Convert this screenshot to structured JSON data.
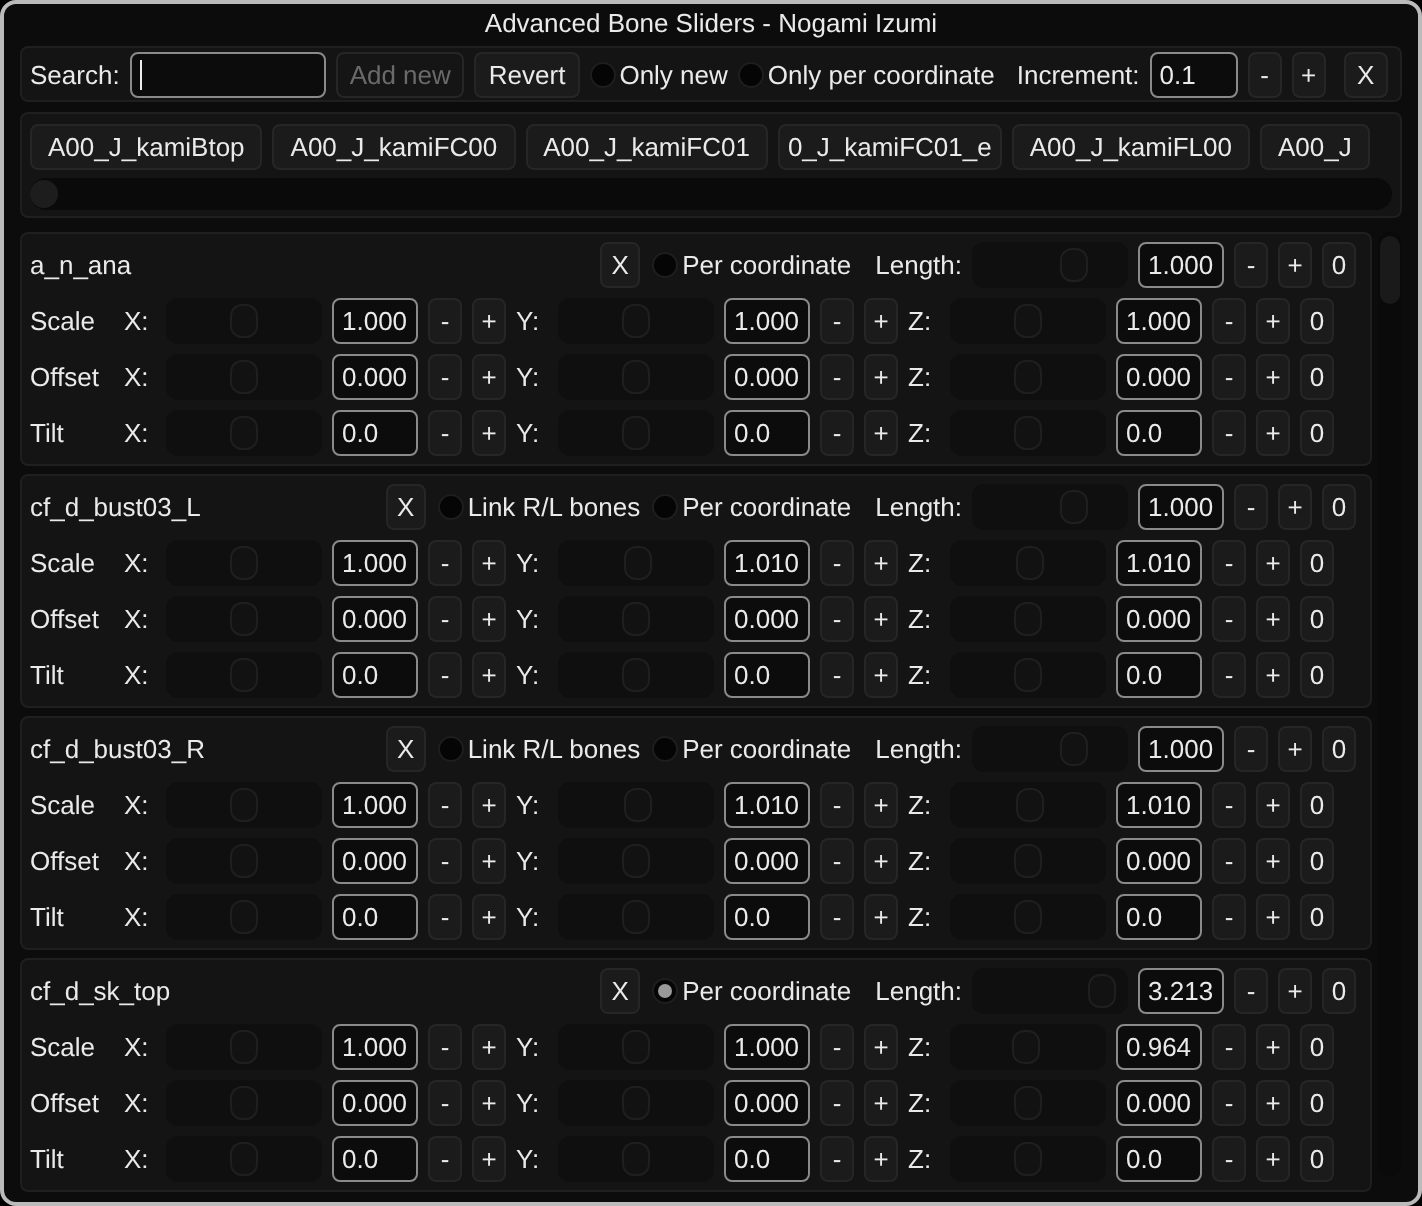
{
  "window": {
    "title": "Advanced Bone Sliders - Nogami Izumi"
  },
  "toolbar": {
    "search_label": "Search:",
    "buttons": [
      {
        "label": "Add new",
        "disabled": true
      },
      {
        "label": "Revert",
        "disabled": false
      }
    ],
    "toggles": [
      {
        "label": "Only new",
        "on": false
      },
      {
        "label": "Only per coordinate",
        "on": false
      }
    ],
    "increment_label": "Increment:",
    "increment_value": "0.1",
    "dec": "-",
    "inc": "+",
    "close": "X"
  },
  "tabs": [
    "A00_J_kamiBtop",
    "A00_J_kamiFC00",
    "A00_J_kamiFC01",
    "0_J_kamiFC01_e",
    "A00_J_kamiFL00",
    "A00_J"
  ],
  "bones": [
    {
      "name": "a_n_ana",
      "remove": "X",
      "toggles": [
        {
          "label": "Per coordinate",
          "on": false
        }
      ],
      "length": {
        "label": "Length:",
        "level": 0.68,
        "value": "1.000",
        "dec": "-",
        "inc": "+",
        "reset": "0"
      },
      "rows": [
        {
          "label": "Scale",
          "reset": "0",
          "axes": [
            {
              "axis": "X:",
              "level": 0.5,
              "value": "1.000",
              "dec": "-",
              "inc": "+"
            },
            {
              "axis": "Y:",
              "level": 0.5,
              "value": "1.000",
              "dec": "-",
              "inc": "+"
            },
            {
              "axis": "Z:",
              "level": 0.5,
              "value": "1.000",
              "dec": "-",
              "inc": "+"
            }
          ]
        },
        {
          "label": "Offset",
          "reset": "0",
          "axes": [
            {
              "axis": "X:",
              "level": 0.5,
              "value": "0.000",
              "dec": "-",
              "inc": "+"
            },
            {
              "axis": "Y:",
              "level": 0.5,
              "value": "0.000",
              "dec": "-",
              "inc": "+"
            },
            {
              "axis": "Z:",
              "level": 0.5,
              "value": "0.000",
              "dec": "-",
              "inc": "+"
            }
          ]
        },
        {
          "label": "Tilt",
          "reset": "0",
          "axes": [
            {
              "axis": "X:",
              "level": 0.5,
              "value": "0.0",
              "dec": "-",
              "inc": "+"
            },
            {
              "axis": "Y:",
              "level": 0.5,
              "value": "0.0",
              "dec": "-",
              "inc": "+"
            },
            {
              "axis": "Z:",
              "level": 0.5,
              "value": "0.0",
              "dec": "-",
              "inc": "+"
            }
          ]
        }
      ]
    },
    {
      "name": "cf_d_bust03_L",
      "remove": "X",
      "toggles": [
        {
          "label": "Link R/L bones",
          "on": false
        },
        {
          "label": "Per coordinate",
          "on": false
        }
      ],
      "length": {
        "label": "Length:",
        "level": 0.68,
        "value": "1.000",
        "dec": "-",
        "inc": "+",
        "reset": "0"
      },
      "rows": [
        {
          "label": "Scale",
          "reset": "0",
          "axes": [
            {
              "axis": "X:",
              "level": 0.5,
              "value": "1.000",
              "dec": "-",
              "inc": "+"
            },
            {
              "axis": "Y:",
              "level": 0.51,
              "value": "1.010",
              "dec": "-",
              "inc": "+"
            },
            {
              "axis": "Z:",
              "level": 0.51,
              "value": "1.010",
              "dec": "-",
              "inc": "+"
            }
          ]
        },
        {
          "label": "Offset",
          "reset": "0",
          "axes": [
            {
              "axis": "X:",
              "level": 0.5,
              "value": "0.000",
              "dec": "-",
              "inc": "+"
            },
            {
              "axis": "Y:",
              "level": 0.5,
              "value": "0.000",
              "dec": "-",
              "inc": "+"
            },
            {
              "axis": "Z:",
              "level": 0.5,
              "value": "0.000",
              "dec": "-",
              "inc": "+"
            }
          ]
        },
        {
          "label": "Tilt",
          "reset": "0",
          "axes": [
            {
              "axis": "X:",
              "level": 0.5,
              "value": "0.0",
              "dec": "-",
              "inc": "+"
            },
            {
              "axis": "Y:",
              "level": 0.5,
              "value": "0.0",
              "dec": "-",
              "inc": "+"
            },
            {
              "axis": "Z:",
              "level": 0.5,
              "value": "0.0",
              "dec": "-",
              "inc": "+"
            }
          ]
        }
      ]
    },
    {
      "name": "cf_d_bust03_R",
      "remove": "X",
      "toggles": [
        {
          "label": "Link R/L bones",
          "on": false
        },
        {
          "label": "Per coordinate",
          "on": false
        }
      ],
      "length": {
        "label": "Length:",
        "level": 0.68,
        "value": "1.000",
        "dec": "-",
        "inc": "+",
        "reset": "0"
      },
      "rows": [
        {
          "label": "Scale",
          "reset": "0",
          "axes": [
            {
              "axis": "X:",
              "level": 0.5,
              "value": "1.000",
              "dec": "-",
              "inc": "+"
            },
            {
              "axis": "Y:",
              "level": 0.51,
              "value": "1.010",
              "dec": "-",
              "inc": "+"
            },
            {
              "axis": "Z:",
              "level": 0.51,
              "value": "1.010",
              "dec": "-",
              "inc": "+"
            }
          ]
        },
        {
          "label": "Offset",
          "reset": "0",
          "axes": [
            {
              "axis": "X:",
              "level": 0.5,
              "value": "0.000",
              "dec": "-",
              "inc": "+"
            },
            {
              "axis": "Y:",
              "level": 0.5,
              "value": "0.000",
              "dec": "-",
              "inc": "+"
            },
            {
              "axis": "Z:",
              "level": 0.5,
              "value": "0.000",
              "dec": "-",
              "inc": "+"
            }
          ]
        },
        {
          "label": "Tilt",
          "reset": "0",
          "axes": [
            {
              "axis": "X:",
              "level": 0.5,
              "value": "0.0",
              "dec": "-",
              "inc": "+"
            },
            {
              "axis": "Y:",
              "level": 0.5,
              "value": "0.0",
              "dec": "-",
              "inc": "+"
            },
            {
              "axis": "Z:",
              "level": 0.5,
              "value": "0.0",
              "dec": "-",
              "inc": "+"
            }
          ]
        }
      ]
    },
    {
      "name": "cf_d_sk_top",
      "remove": "X",
      "toggles": [
        {
          "label": "Per coordinate",
          "on": true
        }
      ],
      "length": {
        "label": "Length:",
        "level": 0.9,
        "value": "3.213",
        "dec": "-",
        "inc": "+",
        "reset": "0"
      },
      "rows": [
        {
          "label": "Scale",
          "reset": "0",
          "axes": [
            {
              "axis": "X:",
              "level": 0.5,
              "value": "1.000",
              "dec": "-",
              "inc": "+"
            },
            {
              "axis": "Y:",
              "level": 0.5,
              "value": "1.000",
              "dec": "-",
              "inc": "+"
            },
            {
              "axis": "Z:",
              "level": 0.48,
              "value": "0.964",
              "dec": "-",
              "inc": "+"
            }
          ]
        },
        {
          "label": "Offset",
          "reset": "0",
          "axes": [
            {
              "axis": "X:",
              "level": 0.5,
              "value": "0.000",
              "dec": "-",
              "inc": "+"
            },
            {
              "axis": "Y:",
              "level": 0.5,
              "value": "0.000",
              "dec": "-",
              "inc": "+"
            },
            {
              "axis": "Z:",
              "level": 0.5,
              "value": "0.000",
              "dec": "-",
              "inc": "+"
            }
          ]
        },
        {
          "label": "Tilt",
          "reset": "0",
          "axes": [
            {
              "axis": "X:",
              "level": 0.5,
              "value": "0.0",
              "dec": "-",
              "inc": "+"
            },
            {
              "axis": "Y:",
              "level": 0.5,
              "value": "0.0",
              "dec": "-",
              "inc": "+"
            },
            {
              "axis": "Z:",
              "level": 0.5,
              "value": "0.0",
              "dec": "-",
              "inc": "+"
            }
          ]
        }
      ]
    }
  ]
}
